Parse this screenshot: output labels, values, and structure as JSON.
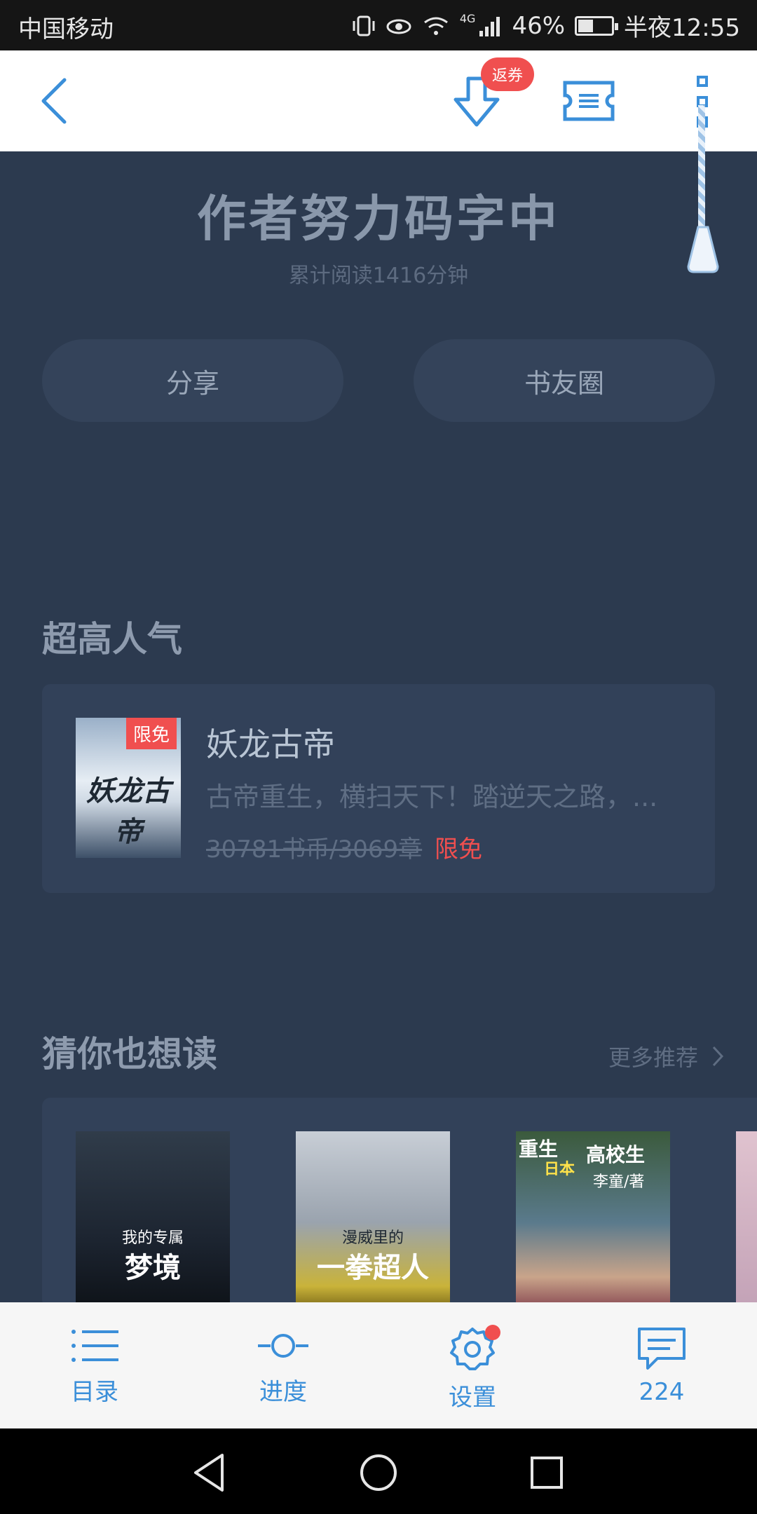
{
  "status_bar": {
    "carrier": "中国移动",
    "network": "4G",
    "battery": "46%",
    "battery_level": 0.46,
    "time": "半夜12:55"
  },
  "top_bar": {
    "coupon_badge": "返券"
  },
  "header": {
    "title": "作者努力码字中",
    "read_minutes": "累计阅读1416分钟"
  },
  "actions": {
    "share": "分享",
    "circle": "书友圈"
  },
  "popular": {
    "title": "超高人气",
    "book": {
      "cover_badge": "限免",
      "cover_title": "妖龙古帝",
      "name": "妖龙古帝",
      "description": "古帝重生，横扫天下！踏逆天之路，...",
      "price": "30781书币/3069章",
      "free": "限免"
    }
  },
  "guess": {
    "title": "猜你也想读",
    "more": "更多推荐",
    "books": [
      {
        "cover_sub": "我的专属",
        "cover_title": "梦境"
      },
      {
        "cover_sub": "漫威里的",
        "cover_title": "一拳超人"
      },
      {
        "cover_top": "重生",
        "cover_jp": "日本",
        "cover_school": "高校生",
        "cover_author": "李童/著"
      }
    ]
  },
  "toolbar": {
    "catalog": "目录",
    "progress": "进度",
    "settings": "设置",
    "comments": "224"
  },
  "colors": {
    "accent": "#3b8fd9",
    "badge_red": "#f04f4f",
    "page_bg": "#2c3a4f",
    "card_bg": "#324159"
  }
}
